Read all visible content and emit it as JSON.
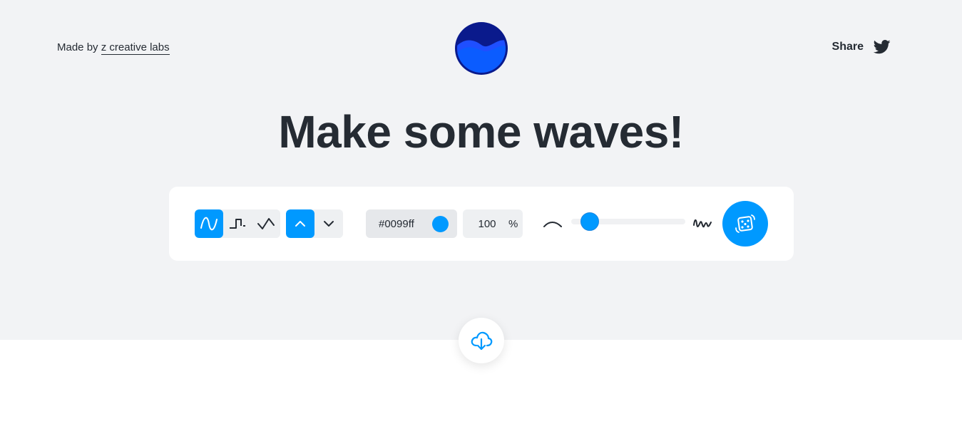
{
  "header": {
    "made_by_prefix": "Made by",
    "made_by_link": "z creative labs",
    "share_label": "Share",
    "logo_icon": "wave-logo-icon",
    "share_icon": "twitter-icon"
  },
  "hero": {
    "title": "Make some waves!"
  },
  "toolbar": {
    "wave_types": [
      {
        "name": "sine-wave-icon",
        "active": true
      },
      {
        "name": "square-wave-icon",
        "active": false
      },
      {
        "name": "triangle-wave-icon",
        "active": false
      }
    ],
    "direction": [
      {
        "name": "chevron-up-icon",
        "active": true
      },
      {
        "name": "chevron-down-icon",
        "active": false
      }
    ],
    "color_hex": "#0099ff",
    "color_swatch": "#0099ff",
    "opacity_value": "100",
    "opacity_unit": "%",
    "complexity_level": 0.16,
    "complexity_min_icon": "smooth-curve-icon",
    "complexity_max_icon": "jagged-wave-icon",
    "randomize_icon": "dice-icon"
  },
  "footer": {
    "download_icon": "cloud-download-icon"
  },
  "colors": {
    "accent": "#0099ff",
    "text": "#252b33",
    "top_bg": "#f2f3f5",
    "logo_dark": "#0a1a8c",
    "logo_light": "#1a66ff"
  }
}
